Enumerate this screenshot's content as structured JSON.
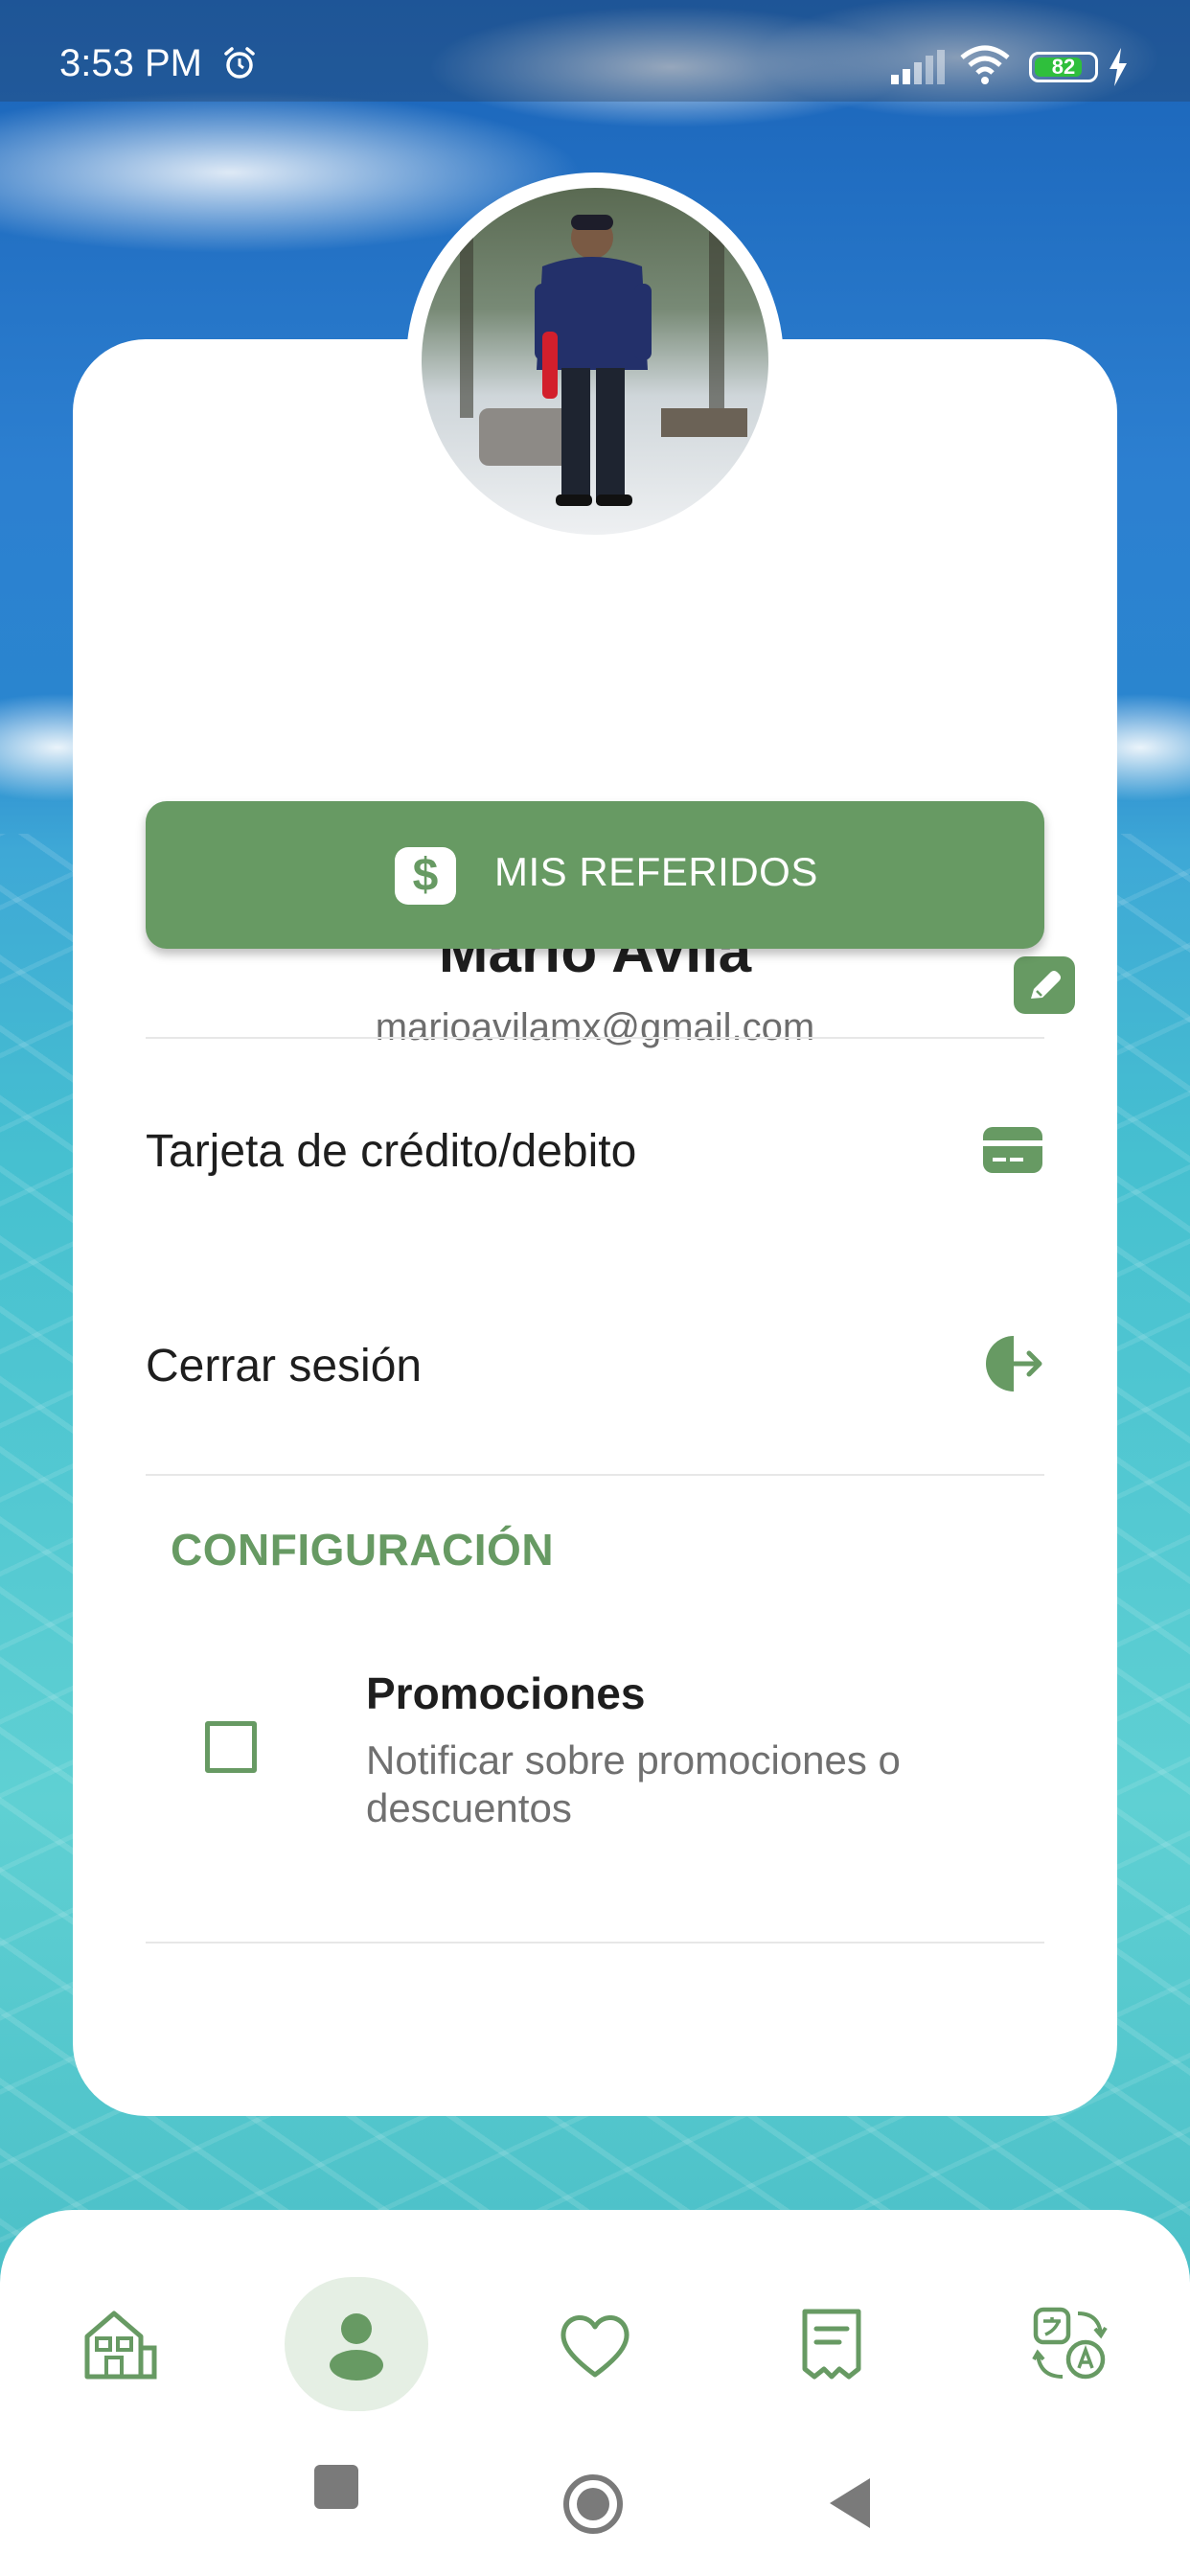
{
  "status_bar": {
    "time": "3:53 PM",
    "battery": "82",
    "battery_level": 0.82,
    "icons": [
      "alarm-icon",
      "signal-icon",
      "wifi-icon",
      "battery-icon",
      "charging-icon"
    ]
  },
  "profile": {
    "name": "Mario Avila",
    "email": "marioavilamx@gmail.com",
    "edit_icon": "pencil-icon"
  },
  "referrals_button": {
    "label": "MIS REFERIDOS",
    "icon": "dollar-icon",
    "icon_glyph": "$"
  },
  "menu": [
    {
      "label": "Tarjeta de crédito/debito",
      "icon": "credit-card-icon"
    },
    {
      "label": "Cerrar sesión",
      "icon": "logout-icon"
    }
  ],
  "settings": {
    "title": "CONFIGURACIÓN",
    "items": [
      {
        "title": "Promociones",
        "description": "Notificar sobre promociones o descuentos",
        "checked": false
      }
    ]
  },
  "bottom_nav": {
    "items": [
      {
        "icon": "home-icon",
        "active": false
      },
      {
        "icon": "profile-icon",
        "active": true
      },
      {
        "icon": "favorites-heart-icon",
        "active": false
      },
      {
        "icon": "receipt-icon",
        "active": false
      },
      {
        "icon": "translate-icon",
        "active": false
      }
    ]
  },
  "system_nav": [
    "recents-button",
    "home-button",
    "back-button"
  ],
  "colors": {
    "accent": "#679a63",
    "accent_light": "#e5efe4",
    "text_primary": "#1e1e1e",
    "text_secondary": "#6d6d6d"
  }
}
